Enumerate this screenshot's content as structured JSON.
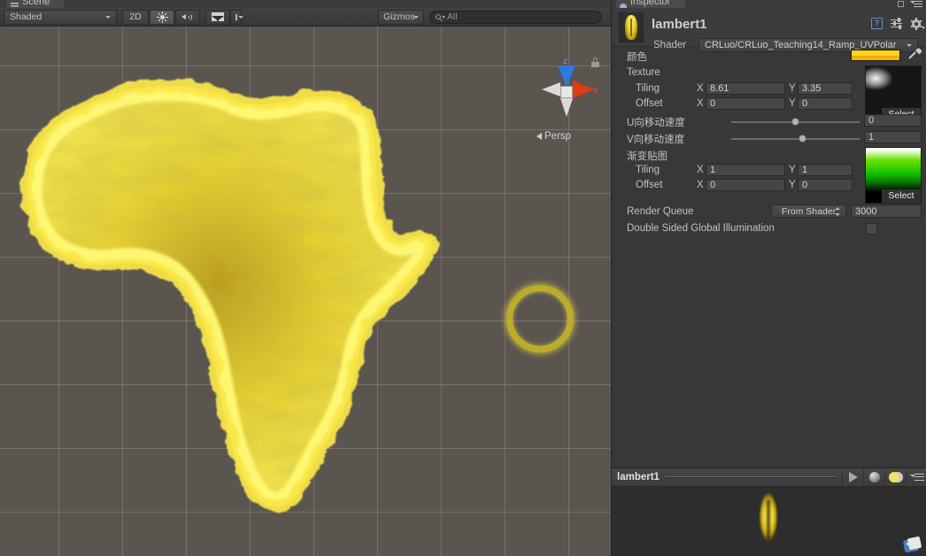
{
  "scene": {
    "tab_label": "Scene",
    "toolbar": {
      "draw_mode": "Shaded",
      "mode_2d": "2D",
      "lighting_icon": "sun-icon",
      "audio_icon": "audio-icon",
      "fx_icon": "image-effects-icon",
      "fx_dropdown_icon": "chevron-down-icon",
      "gizmos_label": "Gizmos",
      "search_placeholder": "All",
      "search_value": "",
      "search_icon": "search-icon"
    },
    "gizmo": {
      "z_label": "z",
      "x_label": "x",
      "projection": "Persp",
      "lock_icon": "lock-icon",
      "z_color": "#2b7ae0",
      "x_color": "#e23b16",
      "neg_axis_color": "#ddd9d6"
    },
    "viewport": {
      "background_color": "#5b5550",
      "grid_color": "#a09890",
      "objects": [
        {
          "name": "africa-mesh",
          "color": "#ffe83c"
        },
        {
          "name": "torus-ring",
          "color": "#f4e83c"
        }
      ]
    }
  },
  "inspector": {
    "tab_label": "Inspector",
    "lock_icon": "lock-icon",
    "menu_icon": "hamburger-menu-icon",
    "material_name": "lambert1",
    "header_icons": [
      {
        "name": "help-icon",
        "glyph": "?"
      },
      {
        "name": "preset-icon"
      },
      {
        "name": "gear-icon"
      }
    ],
    "shader": {
      "label": "Shader",
      "value": "CRLuo/CRLuo_Teaching14_Ramp_UVPolar"
    },
    "properties": {
      "color": {
        "label": "颜色",
        "swatch_hex": "#ffd617",
        "eyedropper_icon": "eyedropper-icon"
      },
      "texture": {
        "label": "Texture",
        "select_label": "Select",
        "tiling_label": "Tiling",
        "offset_label": "Offset",
        "x_axis": "X",
        "y_axis": "Y",
        "tiling_x": "8.61",
        "tiling_y": "3.35",
        "offset_x": "0",
        "offset_y": "0"
      },
      "u_speed": {
        "label": "U向移动速度",
        "value": "0",
        "slider_pct": 50
      },
      "v_speed": {
        "label": "V向移动速度",
        "value": "1",
        "slider_pct": 55
      },
      "ramp": {
        "label": "渐变贴图",
        "select_label": "Select",
        "tiling_label": "Tiling",
        "offset_label": "Offset",
        "x_axis": "X",
        "y_axis": "Y",
        "tiling_x": "1",
        "tiling_y": "1",
        "offset_x": "0",
        "offset_y": "0"
      },
      "render_queue": {
        "label": "Render Queue",
        "mode": "From Shader",
        "value": "3000"
      },
      "double_sided_gi": {
        "label": "Double Sided Global Illumination",
        "checked": false
      }
    },
    "preview": {
      "title": "lambert1",
      "buttons": [
        {
          "name": "play-button",
          "icon": "play-icon"
        },
        {
          "name": "preview-mesh-button",
          "icon": "sphere-icon"
        },
        {
          "name": "lighting-toggle-button",
          "icon": "lighting-icon"
        },
        {
          "name": "preview-options-button",
          "icon": "hamburger-menu-icon"
        }
      ],
      "tag_icon": "tag-icon"
    }
  }
}
